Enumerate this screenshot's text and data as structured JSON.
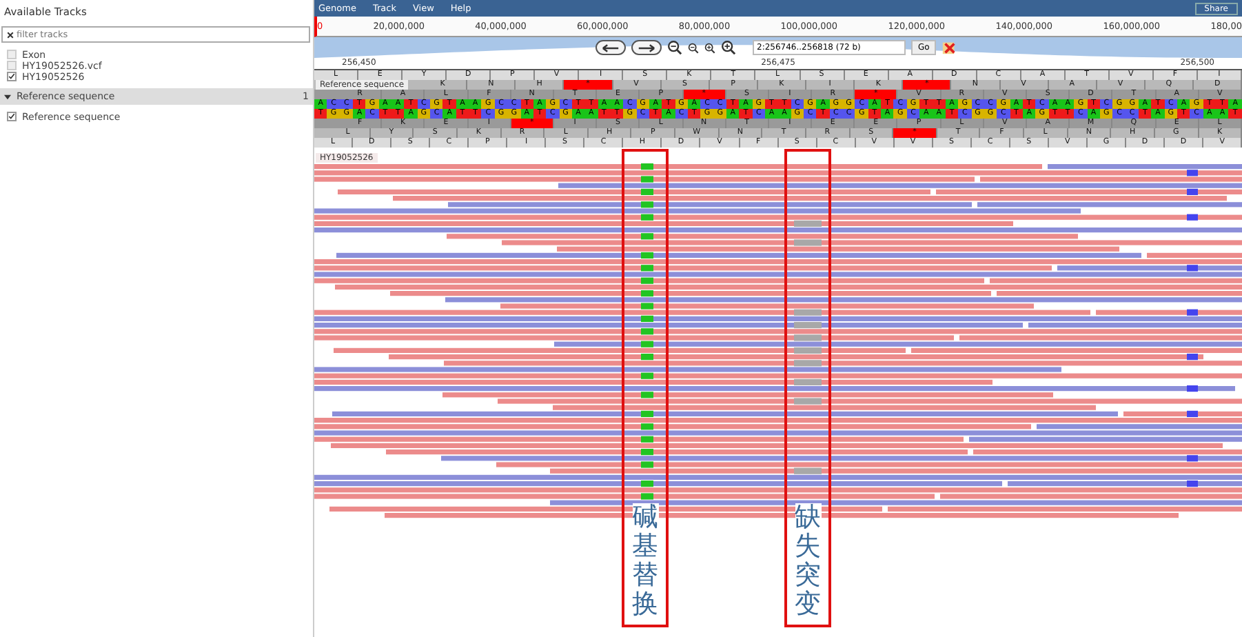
{
  "sidebar": {
    "title": "Available Tracks",
    "filter": {
      "placeholder": "filter tracks"
    },
    "tracks": [
      {
        "label": "Exon",
        "checked": false
      },
      {
        "label": "HY19052526.vcf",
        "checked": false
      },
      {
        "label": "HY19052526",
        "checked": true
      }
    ],
    "categories": [
      {
        "label": "Reference sequence",
        "count": "1",
        "expanded": true,
        "tracks": [
          {
            "label": "Reference sequence",
            "checked": true
          }
        ]
      }
    ]
  },
  "menu": {
    "items": [
      "Genome",
      "Track",
      "View",
      "Help"
    ],
    "share": "Share"
  },
  "overview": {
    "ticks": [
      "0",
      "20,000,000",
      "40,000,000",
      "60,000,000",
      "80,000,000",
      "100,000,000",
      "120,000,000",
      "140,000,000",
      "160,000,000",
      "180,00"
    ]
  },
  "navigation": {
    "location": "2:256746..256818 (72 b)",
    "go": "Go"
  },
  "scale": {
    "ticks": [
      "256,450",
      "256,475",
      "256,500"
    ]
  },
  "sequence_track": {
    "label": "Reference sequence",
    "forward_frames": [
      [
        "L",
        "E",
        "Y",
        "D",
        "P",
        "V",
        "I",
        "S",
        "K",
        "T",
        "L",
        "S",
        "E",
        "A",
        "D",
        "C",
        "A",
        "T",
        "V",
        "F",
        "I"
      ],
      [
        "K",
        "N",
        "H",
        "*",
        "V",
        "S",
        "P",
        "K",
        "I",
        "K",
        "*",
        "N",
        "V",
        "A",
        "V",
        "Q",
        "D"
      ],
      [
        "R",
        "A",
        "L",
        "F",
        "N",
        "T",
        "E",
        "P",
        "*",
        "S",
        "I",
        "R",
        "*",
        "V",
        "R",
        "V",
        "S",
        "D",
        "T",
        "A",
        "V"
      ]
    ],
    "bases": [
      "A",
      "C",
      "C",
      "T",
      "G",
      "A",
      "A",
      "T",
      "C",
      "G",
      "T",
      "A",
      "A",
      "G",
      "C",
      "C",
      "T",
      "A",
      "G",
      "C",
      "T",
      "T",
      "A",
      "A",
      "C",
      "G",
      "A",
      "T",
      "G",
      "A",
      "C",
      "C",
      "T",
      "A",
      "G",
      "T",
      "T",
      "C",
      "G",
      "A",
      "G",
      "G",
      "C",
      "A",
      "T",
      "C",
      "G",
      "T",
      "T",
      "A",
      "G",
      "C",
      "C",
      "G",
      "A",
      "T",
      "C",
      "A",
      "A",
      "G",
      "T",
      "C",
      "G",
      "G",
      "A",
      "T",
      "C",
      "A",
      "G",
      "T",
      "T",
      "A"
    ],
    "complement": [
      "T",
      "G",
      "G",
      "A",
      "C",
      "T",
      "T",
      "A",
      "G",
      "C",
      "A",
      "T",
      "T",
      "C",
      "G",
      "G",
      "A",
      "T",
      "C",
      "G",
      "A",
      "A",
      "T",
      "T",
      "G",
      "C",
      "T",
      "A",
      "C",
      "T",
      "G",
      "G",
      "A",
      "T",
      "C",
      "A",
      "A",
      "G",
      "C",
      "T",
      "C",
      "C",
      "G",
      "T",
      "A",
      "G",
      "C",
      "A",
      "A",
      "T",
      "C",
      "G",
      "G",
      "C",
      "T",
      "A",
      "G",
      "T",
      "T",
      "C",
      "A",
      "G",
      "C",
      "C",
      "T",
      "A",
      "G",
      "T",
      "C",
      "A",
      "A",
      "T"
    ],
    "reverse_frames": [
      [
        "F",
        "K",
        "E",
        "I",
        "*",
        "I",
        "S",
        "L",
        "N",
        "T",
        "I",
        "E",
        "E",
        "P",
        "L",
        "V",
        "A",
        "M",
        "Q",
        "E",
        "L"
      ],
      [
        "L",
        "Y",
        "S",
        "K",
        "R",
        "L",
        "H",
        "P",
        "W",
        "N",
        "T",
        "R",
        "S",
        "*",
        "T",
        "F",
        "L",
        "N",
        "H",
        "G",
        "K"
      ],
      [
        "L",
        "D",
        "S",
        "C",
        "P",
        "I",
        "S",
        "C",
        "H",
        "D",
        "V",
        "F",
        "S",
        "C",
        "V",
        "V",
        "S",
        "C",
        "S",
        "V",
        "G",
        "D",
        "D",
        "V"
      ]
    ]
  },
  "alignment_track": {
    "label": "HY19052526"
  },
  "annotations": [
    {
      "label": "碱基替换"
    },
    {
      "label": "缺失突变"
    }
  ]
}
